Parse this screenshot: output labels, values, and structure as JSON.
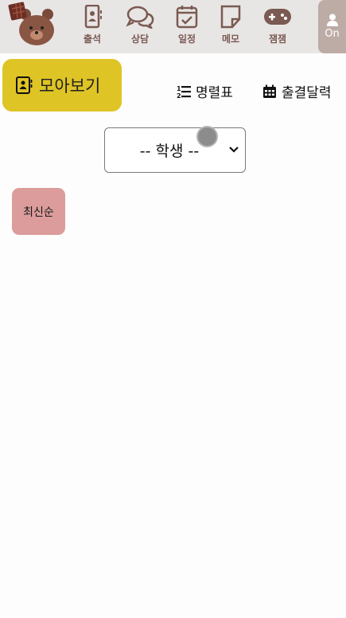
{
  "colors": {
    "topbar_bg": "#e8e6e5",
    "nav_icon": "#7a5a52",
    "on_button_bg": "#bdaba6",
    "gather_button_bg": "#dec425",
    "sort_button_bg": "#dc9c9c"
  },
  "header": {
    "logo_icon": "bear-chocolate-logo",
    "nav": [
      {
        "label": "출석",
        "icon": "contact-book-icon"
      },
      {
        "label": "상담",
        "icon": "chat-bubbles-icon"
      },
      {
        "label": "일정",
        "icon": "calendar-check-icon"
      },
      {
        "label": "메모",
        "icon": "sticky-note-icon"
      },
      {
        "label": "잼잼",
        "icon": "gamepad-icon"
      }
    ],
    "on_button": {
      "label": "On",
      "icon": "user-icon"
    }
  },
  "toolbar": {
    "gather_label": "모아보기",
    "roster_label": "명렬표",
    "attendance_calendar_label": "출결달력"
  },
  "filters": {
    "student_select_value": "-- 학생 --"
  },
  "sort": {
    "latest_label": "최신순"
  }
}
